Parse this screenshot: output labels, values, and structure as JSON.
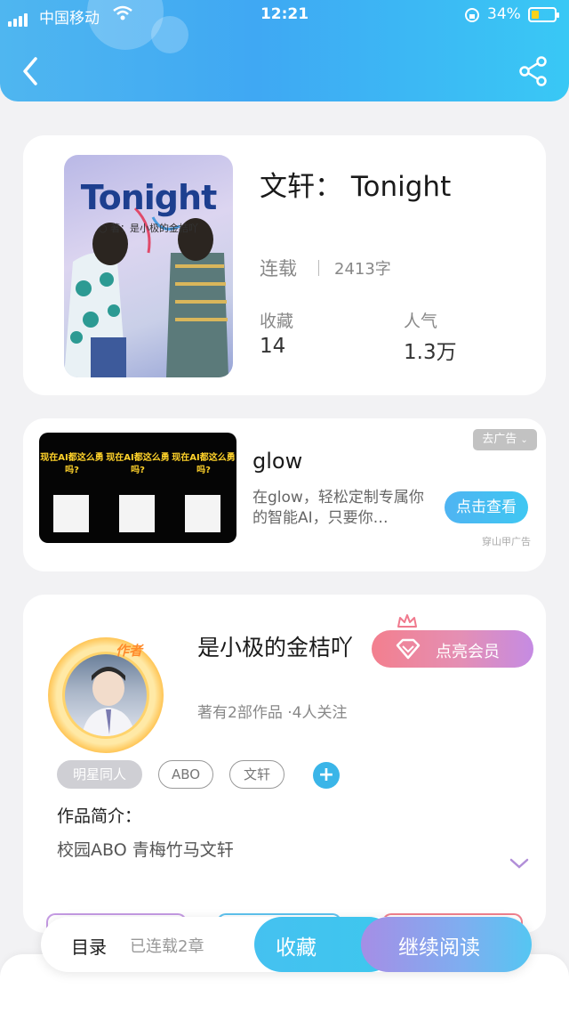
{
  "status_bar": {
    "carrier": "中国移动",
    "time": "12:21",
    "battery": "34%",
    "battery_level": 0.34
  },
  "header": {
    "back_icon": "chevron-left-icon",
    "share_icon": "share-icon"
  },
  "book": {
    "cover_title": "Tonight",
    "cover_subtitle": "○ 著：是小极的金桔吖",
    "title": "文轩： Tonight",
    "status": "连载",
    "word_count": "2413字",
    "favorites_label": "收藏",
    "favorites_value": "14",
    "popularity_label": "人气",
    "popularity_value": "1.3万"
  },
  "ad": {
    "meme_text": "现在AI都这么勇吗?",
    "close_label": "去广告",
    "name": "glow",
    "description": "在glow，轻松定制专属你的智能AI，只要你…",
    "button_label": "点击查看",
    "source": "穿山甲广告"
  },
  "author": {
    "badge": "作者",
    "name": "是小极的金桔吖",
    "vip_button": "点亮会员",
    "meta": "著有2部作品 ·4人关注",
    "tags": [
      "明星同人",
      "ABO",
      "文轩"
    ],
    "intro_label": "作品简介：",
    "intro_text": "校园ABO  青梅竹马文轩"
  },
  "bottom_bar": {
    "toc_label": "目录",
    "serial_count": "已连载2章",
    "collect_label": "收藏",
    "read_label": "继续阅读"
  },
  "colors": {
    "header_blue": "#3fa8f3",
    "accent_blue": "#3ab5e8",
    "vip_pink": "#f37f8e",
    "vip_purple": "#c58be3",
    "battery_yellow": "#f7d21c"
  }
}
